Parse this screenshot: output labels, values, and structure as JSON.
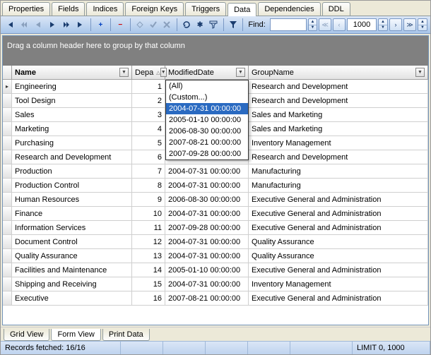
{
  "tabs": [
    "Properties",
    "Fields",
    "Indices",
    "Foreign Keys",
    "Triggers",
    "Data",
    "Dependencies",
    "DDL"
  ],
  "activeTab": "Data",
  "toolbar": {
    "find_label": "Find:",
    "find_value": "",
    "page_count": "1000"
  },
  "group_band": "Drag a column header here to group by that column",
  "columns": {
    "name": "Name",
    "dep": "Depa",
    "mod": "ModifiedDate",
    "grp": "GroupName"
  },
  "filter_dropdown": {
    "items": [
      "(All)",
      "(Custom...)",
      "2004-07-31 00:00:00",
      "2005-01-10 00:00:00",
      "2006-08-30 00:00:00",
      "2007-08-21 00:00:00",
      "2007-09-28 00:00:00"
    ],
    "selectedIndex": 2
  },
  "rows": [
    {
      "name": "Engineering",
      "dep": "1",
      "mod": "",
      "grp": "Research and Development",
      "current": true
    },
    {
      "name": "Tool Design",
      "dep": "2",
      "mod": "",
      "grp": "Research and Development"
    },
    {
      "name": "Sales",
      "dep": "3",
      "mod": "",
      "grp": "Sales and Marketing"
    },
    {
      "name": "Marketing",
      "dep": "4",
      "mod": "",
      "grp": "Sales and Marketing"
    },
    {
      "name": "Purchasing",
      "dep": "5",
      "mod": "",
      "grp": "Inventory Management"
    },
    {
      "name": "Research and Development",
      "dep": "6",
      "mod": "2004-07-31 00:00:00",
      "grp": "Research and Development"
    },
    {
      "name": "Production",
      "dep": "7",
      "mod": "2004-07-31 00:00:00",
      "grp": "Manufacturing"
    },
    {
      "name": "Production Control",
      "dep": "8",
      "mod": "2004-07-31 00:00:00",
      "grp": "Manufacturing"
    },
    {
      "name": "Human Resources",
      "dep": "9",
      "mod": "2006-08-30 00:00:00",
      "grp": "Executive General and Administration"
    },
    {
      "name": "Finance",
      "dep": "10",
      "mod": "2004-07-31 00:00:00",
      "grp": "Executive General and Administration"
    },
    {
      "name": "Information Services",
      "dep": "11",
      "mod": "2007-09-28 00:00:00",
      "grp": "Executive General and Administration"
    },
    {
      "name": "Document Control",
      "dep": "12",
      "mod": "2004-07-31 00:00:00",
      "grp": "Quality Assurance"
    },
    {
      "name": "Quality Assurance",
      "dep": "13",
      "mod": "2004-07-31 00:00:00",
      "grp": "Quality Assurance"
    },
    {
      "name": "Facilities and Maintenance",
      "dep": "14",
      "mod": "2005-01-10 00:00:00",
      "grp": "Executive General and Administration"
    },
    {
      "name": "Shipping and Receiving",
      "dep": "15",
      "mod": "2004-07-31 00:00:00",
      "grp": "Inventory Management"
    },
    {
      "name": "Executive",
      "dep": "16",
      "mod": "2007-08-21 00:00:00",
      "grp": "Executive General and Administration"
    }
  ],
  "bottom_tabs": [
    "Grid View",
    "Form View",
    "Print Data"
  ],
  "active_bottom_tab": "Form View",
  "status": {
    "records": "Records fetched: 16/16",
    "limit": "LIMIT 0, 1000"
  }
}
